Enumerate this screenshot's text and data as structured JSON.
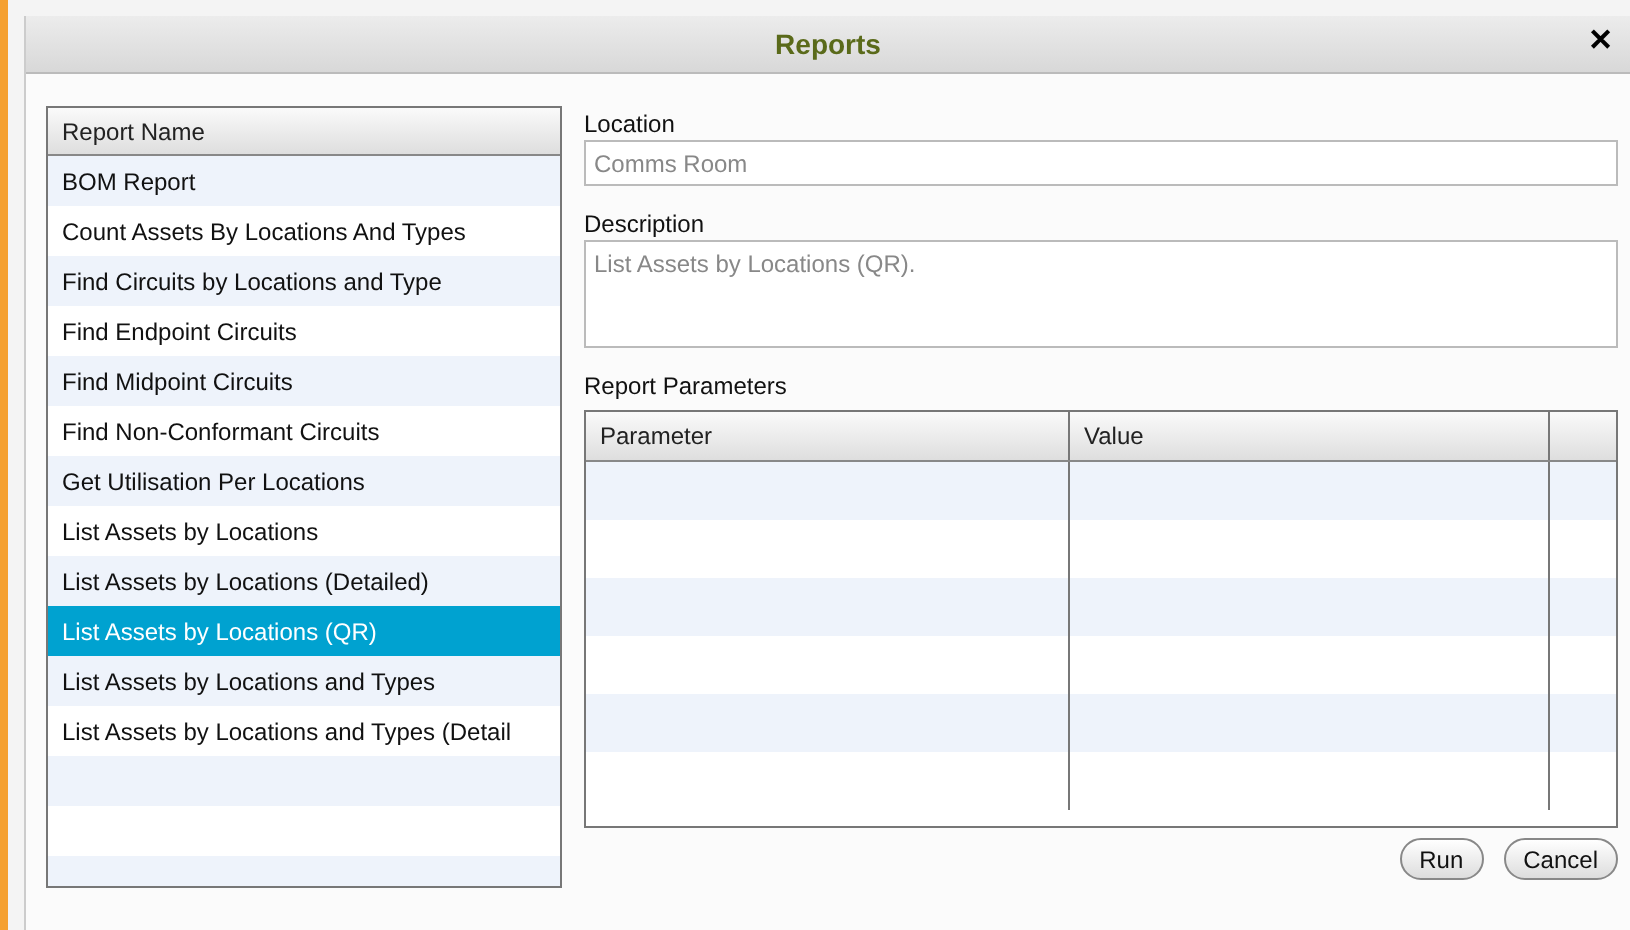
{
  "dialog": {
    "title": "Reports",
    "close": "✕"
  },
  "report_list": {
    "column": "Report Name",
    "items": [
      {
        "label": "BOM Report",
        "selected": false
      },
      {
        "label": "Count Assets By Locations And Types",
        "selected": false
      },
      {
        "label": "Find Circuits by Locations and Type",
        "selected": false
      },
      {
        "label": "Find Endpoint Circuits",
        "selected": false
      },
      {
        "label": "Find Midpoint Circuits",
        "selected": false
      },
      {
        "label": "Find Non-Conformant Circuits",
        "selected": false
      },
      {
        "label": "Get Utilisation Per Locations",
        "selected": false
      },
      {
        "label": "List Assets by Locations",
        "selected": false
      },
      {
        "label": "List Assets by Locations (Detailed)",
        "selected": false
      },
      {
        "label": "List Assets by Locations (QR)",
        "selected": true
      },
      {
        "label": "List Assets by Locations and Types",
        "selected": false
      },
      {
        "label": "List Assets by Locations and Types (Detail",
        "selected": false
      }
    ]
  },
  "location": {
    "label": "Location",
    "value": "Comms Room"
  },
  "description": {
    "label": "Description",
    "value": "List Assets by Locations (QR)."
  },
  "parameters": {
    "label": "Report Parameters",
    "columns": [
      "Parameter",
      "Value"
    ]
  },
  "buttons": [
    "Run",
    "Cancel"
  ]
}
